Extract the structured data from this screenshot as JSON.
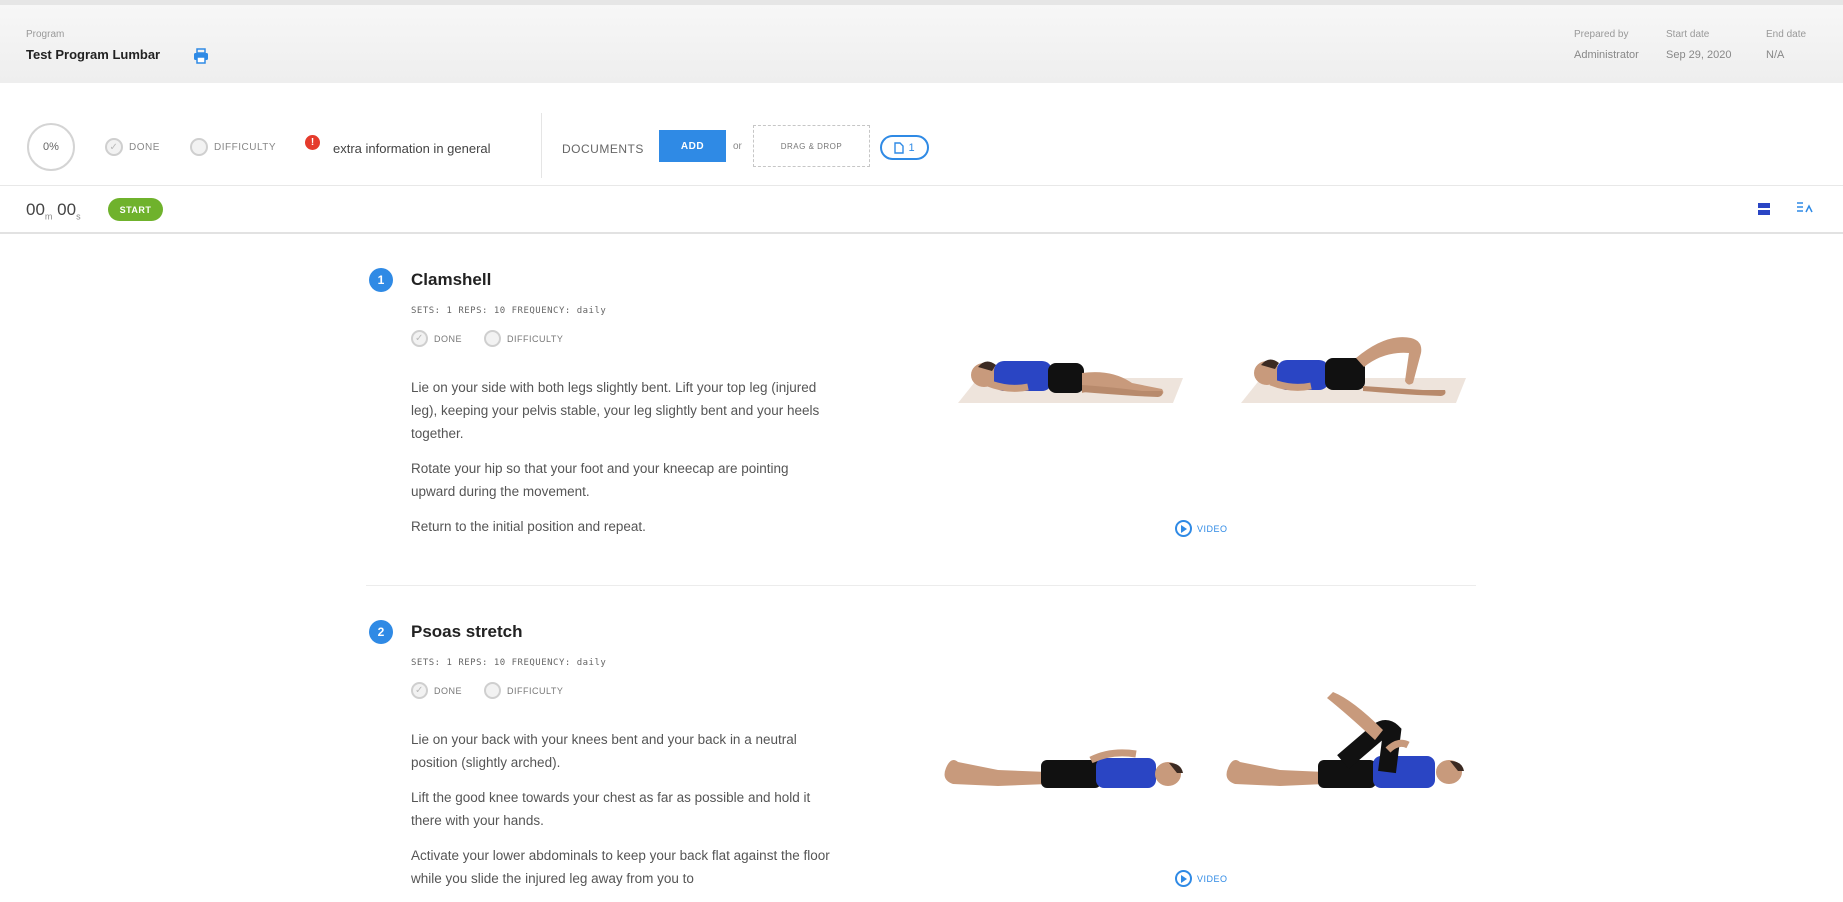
{
  "header": {
    "program_label": "Program",
    "program_name": "Test Program Lumbar",
    "prepared_by_label": "Prepared by",
    "prepared_by_value": "Administrator",
    "start_date_label": "Start date",
    "start_date_value": "Sep 29, 2020",
    "end_date_label": "End date",
    "end_date_value": "N/A"
  },
  "status": {
    "progress": "0%",
    "done_label": "DONE",
    "difficulty_label": "DIFFICULTY",
    "alert_symbol": "!",
    "extra_info": "extra information in general",
    "documents_label": "DOCUMENTS",
    "add_label": "ADD",
    "or_label": "or",
    "drop_label": "DRAG & DROP",
    "doc_count": "1"
  },
  "timer": {
    "minutes": "00",
    "minutes_unit": "m",
    "seconds": "00",
    "seconds_unit": "s",
    "start_label": "START"
  },
  "exercises": [
    {
      "number": "1",
      "title": "Clamshell",
      "meta": "SETS: 1   REPS: 10   FREQUENCY: daily",
      "done_label": "DONE",
      "difficulty_label": "DIFFICULTY",
      "paragraphs": [
        "Lie on your side with both legs slightly bent. Lift your top leg (injured leg), keeping your pelvis stable, your leg slightly bent and your heels together.",
        "Rotate your hip so that your foot and your kneecap are pointing upward during the movement.",
        "Return to the initial position and repeat."
      ],
      "video_label": "VIDEO"
    },
    {
      "number": "2",
      "title": "Psoas stretch",
      "meta": "SETS: 1   REPS: 10   FREQUENCY: daily",
      "done_label": "DONE",
      "difficulty_label": "DIFFICULTY",
      "paragraphs": [
        "Lie on your back with your knees bent and your back in a neutral position (slightly arched).",
        "Lift the good knee towards your chest as far as possible and hold it there with your hands.",
        "Activate your lower abdominals to keep your back flat against the floor while you slide the injured leg away from you to"
      ],
      "video_label": "VIDEO"
    }
  ],
  "colors": {
    "accent": "#2f8ae5",
    "start_green": "#6fb22c",
    "alert_red": "#e53b2c",
    "shirt_blue": "#2a45c4"
  },
  "icons": {
    "print": "printer-icon",
    "list_view": "list-view-icon",
    "grid_view": "grid-view-icon",
    "video": "play-circle-icon",
    "document": "document-icon"
  }
}
